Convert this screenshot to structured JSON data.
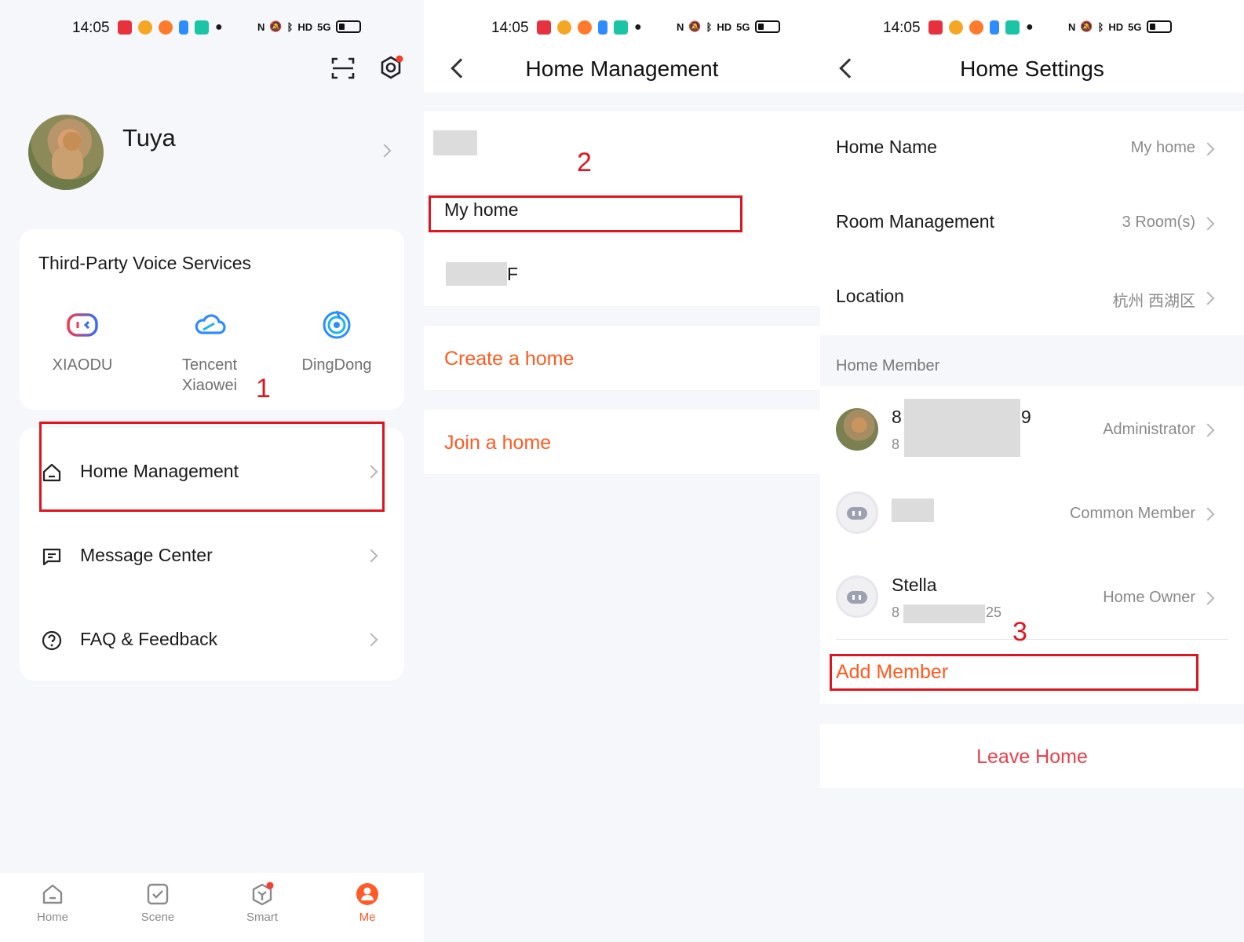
{
  "status_bar": {
    "time": "14:05",
    "network": "5G"
  },
  "panel_me": {
    "username": "Tuya",
    "voice_services": {
      "title": "Third-Party Voice Services",
      "items": [
        {
          "label": "XIAODU",
          "icon": "xiaodu-icon"
        },
        {
          "label": "Tencent Xiaowei",
          "icon": "tencent-cloud-icon"
        },
        {
          "label": "DingDong",
          "icon": "dingdong-icon"
        }
      ]
    },
    "menu": [
      {
        "label": "Home Management",
        "icon": "home-icon"
      },
      {
        "label": "Message Center",
        "icon": "message-icon"
      },
      {
        "label": "FAQ & Feedback",
        "icon": "question-icon"
      }
    ],
    "tabs": [
      {
        "label": "Home",
        "icon": "home-tab-icon",
        "active": false
      },
      {
        "label": "Scene",
        "icon": "scene-tab-icon",
        "active": false
      },
      {
        "label": "Smart",
        "icon": "smart-tab-icon",
        "active": false
      },
      {
        "label": "Me",
        "icon": "me-tab-icon",
        "active": true
      }
    ],
    "step": "1"
  },
  "panel_home_management": {
    "title": "Home Management",
    "homes": [
      {
        "label": "My home"
      }
    ],
    "partial_home_suffix": "F",
    "create_label": "Create a home",
    "join_label": "Join a home",
    "step": "2"
  },
  "panel_home_settings": {
    "title": "Home Settings",
    "rows": [
      {
        "label": "Home Name",
        "value": "My home"
      },
      {
        "label": "Room Management",
        "value": "3 Room(s)"
      },
      {
        "label": "Location",
        "value": "杭州 西湖区"
      }
    ],
    "member_section_title": "Home Member",
    "members": [
      {
        "name_start": "8",
        "name_end": "9",
        "phone_start": "8",
        "role": "Administrator"
      },
      {
        "role": "Common Member"
      },
      {
        "name": "Stella",
        "phone_start": "8",
        "phone_end": "25",
        "role": "Home Owner"
      }
    ],
    "add_member_label": "Add Member",
    "leave_label": "Leave Home",
    "step": "3"
  },
  "colors": {
    "accent": "#ff5a1f",
    "annotation": "#e0141e",
    "leave": "#e8404a"
  }
}
